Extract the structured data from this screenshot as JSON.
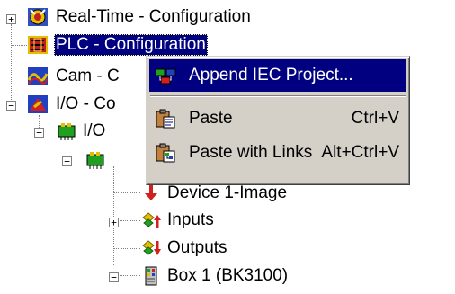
{
  "tree": {
    "items": [
      {
        "label": "Real-Time - Configuration",
        "icon": "realtime-config-icon"
      },
      {
        "label": "PLC - Configuration",
        "icon": "plc-config-icon",
        "selected": true
      },
      {
        "label": "Cam - C",
        "icon": "cam-config-icon"
      },
      {
        "label": "I/O - Co",
        "icon": "io-config-icon"
      },
      {
        "label": "I/O",
        "icon": "io-devices-icon"
      },
      {
        "label": "",
        "icon": "device-icon"
      },
      {
        "label": "Device 1-Image",
        "icon": "device-image-icon"
      },
      {
        "label": "Inputs",
        "icon": "inputs-icon"
      },
      {
        "label": "Outputs",
        "icon": "outputs-icon"
      },
      {
        "label": "Box 1 (BK3100)",
        "icon": "box-icon"
      }
    ]
  },
  "context_menu": {
    "items": [
      {
        "label": "Append IEC Project...",
        "shortcut": "",
        "icon": "append-iec-project-icon",
        "highlighted": true
      },
      {
        "label": "Paste",
        "shortcut": "Ctrl+V",
        "icon": "paste-icon"
      },
      {
        "label": "Paste with Links",
        "shortcut": "Alt+Ctrl+V",
        "icon": "paste-with-links-icon"
      }
    ]
  },
  "colors": {
    "selection": "#000080",
    "menu_background": "#d4d0c8"
  }
}
